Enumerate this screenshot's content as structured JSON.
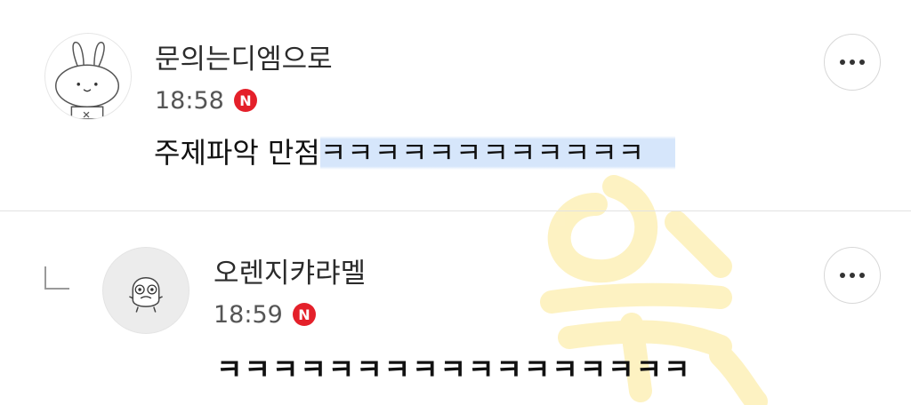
{
  "comments": [
    {
      "nickname": "문의는디엠으로",
      "time": "18:58",
      "badge": "N",
      "text_plain": "주제파악 만점",
      "text_highlight": "ㅋㅋㅋㅋㅋㅋㅋㅋㅋㅋㅋㅋ",
      "avatar_icon": "bunny-avatar-icon",
      "more_icon": "more-options-icon"
    },
    {
      "nickname": "오렌지캬랴멜",
      "time": "18:59",
      "badge": "N",
      "text": "ㅋㅋㅋㅋㅋㅋㅋㅋㅋㅋㅋㅋㅋㅋㅋㅋㅋ",
      "avatar_icon": "character-avatar-icon",
      "reply_icon": "reply-indent-icon",
      "more_icon": "more-options-icon"
    }
  ],
  "colors": {
    "badge": "#e4202a",
    "highlight": "#d6e6fb",
    "watermark": "#fdf0b8"
  },
  "watermark_icon": "watermark-icon"
}
